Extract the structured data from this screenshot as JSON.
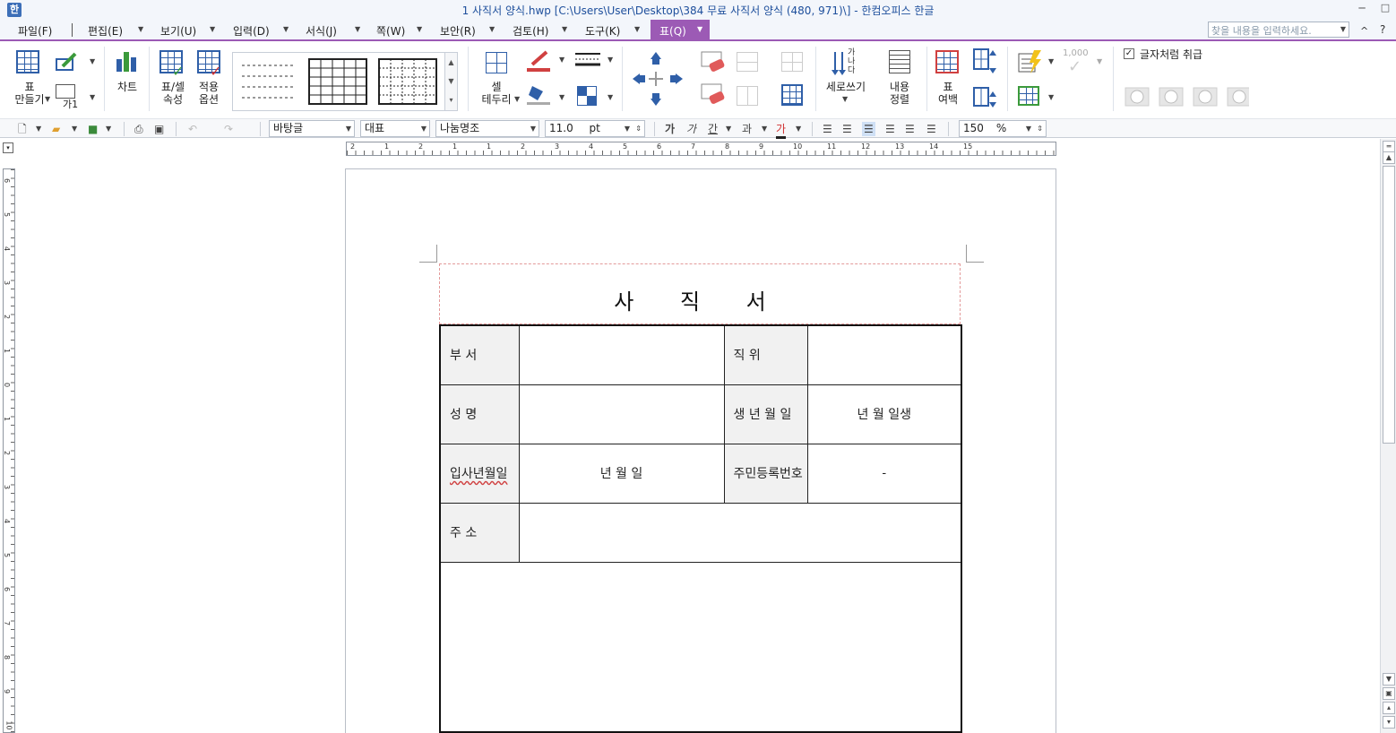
{
  "window": {
    "app_icon": "한",
    "title": "1 사직서 양식.hwp [C:\\Users\\User\\Desktop\\384 무료 사직서 양식 (480, 971)\\] - 한컴오피스 한글",
    "minimize": "─",
    "restore": "□"
  },
  "menu": {
    "items": [
      "파일(F)",
      "편집(E)",
      "보기(U)",
      "입력(D)",
      "서식(J)",
      "쪽(W)",
      "보안(R)",
      "검토(H)",
      "도구(K)",
      "표(Q)"
    ],
    "dropdown_glyph": "▼",
    "search_placeholder": "찾을 내용을 입력하세요.",
    "collapse_glyph": "^",
    "help_glyph": "?"
  },
  "ribbon": {
    "make_table": "표\n만들기",
    "glyph_label": "가1",
    "chart": "차트",
    "table_cell_props": "표/셀\n속성",
    "apply_options": "적용\n옵션",
    "cell_border": "셀\n테두리",
    "vertical_writing": "세로쓰기",
    "content_align": "내용\n정렬",
    "table_margin": "표\n여백",
    "number_format": "1,000",
    "treat_as_char": "글자처럼 취급",
    "treat_as_char_checked": true,
    "vertical_glyph": "가\n나\n다"
  },
  "format_bar": {
    "style": "바탕글",
    "lang": "대표",
    "font": "나눔명조",
    "size": "11.0",
    "size_unit": "pt",
    "bold": "가",
    "italic": "가",
    "underline": "간",
    "strike": "과",
    "color": "가",
    "zoom": "150",
    "zoom_unit": "%"
  },
  "ruler": {
    "h_ticks": [
      "2",
      "1",
      "2",
      "1",
      "1",
      "2",
      "3",
      "4",
      "5",
      "6",
      "7",
      "8",
      "9",
      "10",
      "11",
      "12",
      "13",
      "14",
      "15"
    ],
    "v_ticks": [
      "6",
      "5",
      "4",
      "3",
      "2",
      "1",
      "0",
      "1",
      "2",
      "3",
      "4",
      "5",
      "6",
      "7",
      "8",
      "9",
      "10"
    ]
  },
  "document": {
    "title": "사 직 서",
    "rows": [
      {
        "label1": "부        서",
        "value1": "",
        "label2": "직        위",
        "value2": ""
      },
      {
        "label1": "성        명",
        "value1": "",
        "label2": "생 년 월 일",
        "value2": "년      월      일생"
      },
      {
        "label1": "입사년월일",
        "value1": "년      월      일",
        "label2": "주민등록번호",
        "value2": "-"
      },
      {
        "label1": "주        소",
        "value1": ""
      }
    ]
  },
  "colors": {
    "accent": "#9c5ab5",
    "title_text": "#1e4f9c"
  }
}
